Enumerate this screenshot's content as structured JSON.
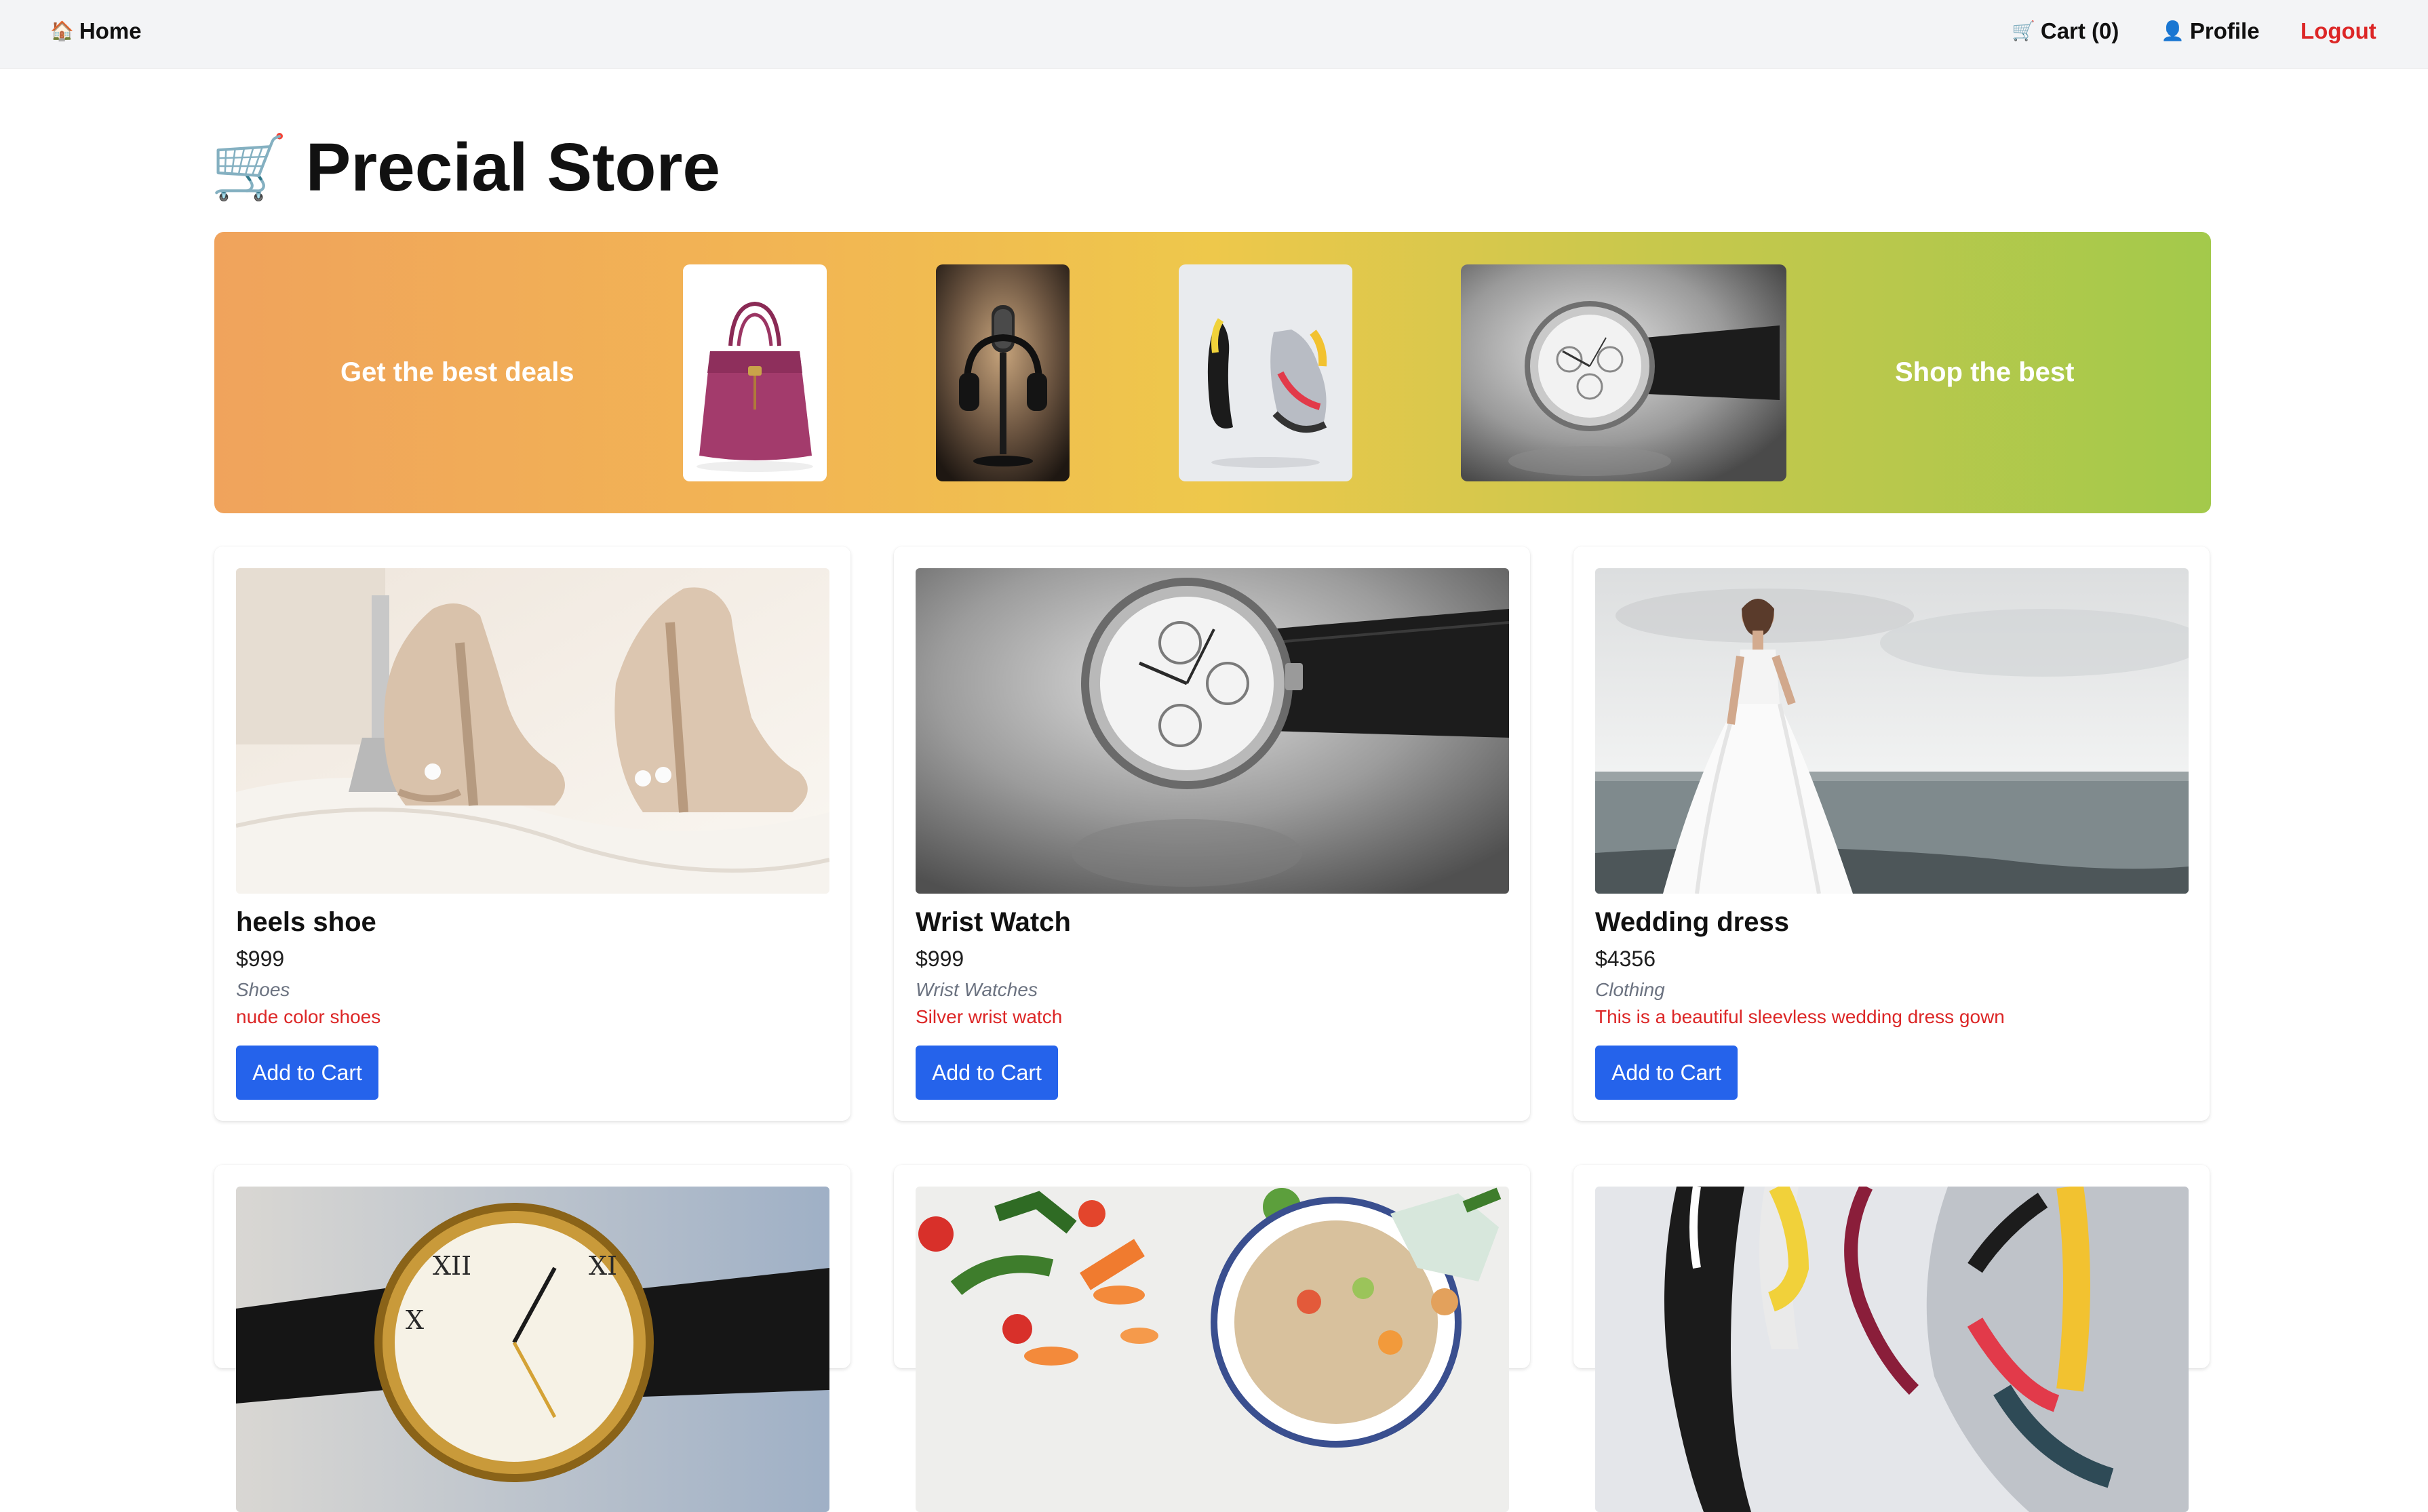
{
  "nav": {
    "home": {
      "icon": "house-icon",
      "glyph": "🏠",
      "label": "Home"
    },
    "cart": {
      "icon": "cart-icon",
      "glyph": "🛒",
      "label": "Cart (0)"
    },
    "profile": {
      "icon": "person-icon",
      "glyph": "👤",
      "label": "Profile"
    },
    "logout": {
      "label": "Logout",
      "color": "#dc2626"
    }
  },
  "page": {
    "title_icon": "cart-icon",
    "title_glyph": "🛒",
    "title": "Precial Store"
  },
  "banner": {
    "left_text": "Get the best deals",
    "right_text": "Shop the best",
    "images": [
      "handbag-image",
      "microphone-headphones-image",
      "sneakers-image",
      "wrist-watch-image"
    ],
    "gradient": [
      "#f0a35c",
      "#eec84b",
      "#a3c94b"
    ]
  },
  "products": [
    {
      "name": "heels shoe",
      "price": "$999",
      "category": "Shoes",
      "description": "nude color shoes",
      "button": "Add to Cart",
      "image": "heels-shoe-image"
    },
    {
      "name": "Wrist Watch",
      "price": "$999",
      "category": "Wrist Watches",
      "description": "Silver wrist watch",
      "button": "Add to Cart",
      "image": "wrist-watch-image"
    },
    {
      "name": "Wedding dress",
      "price": "$4356",
      "category": "Clothing",
      "description": "This is a beautiful sleevless wedding dress gown",
      "button": "Add to Cart",
      "image": "wedding-dress-image"
    },
    {
      "image": "gold-watch-image"
    },
    {
      "image": "food-vegetables-image"
    },
    {
      "image": "sneakers-image"
    }
  ],
  "colors": {
    "accent_button": "#2563eb",
    "description_text": "#dc2626",
    "category_text": "#6b7280",
    "nav_background": "#f3f4f6"
  }
}
